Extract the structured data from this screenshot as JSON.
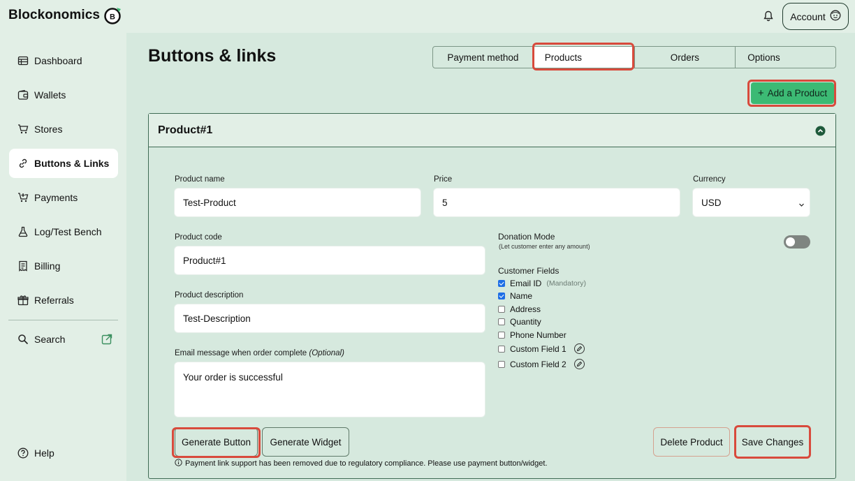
{
  "brand": {
    "name": "Blockonomics",
    "logo_letter": "B"
  },
  "header": {
    "account_label": "Account"
  },
  "sidebar": {
    "items": [
      {
        "label": "Dashboard",
        "icon": "table-icon"
      },
      {
        "label": "Wallets",
        "icon": "wallet-icon"
      },
      {
        "label": "Stores",
        "icon": "cart-icon"
      },
      {
        "label": "Buttons & Links",
        "icon": "link-icon",
        "active": true
      },
      {
        "label": "Payments",
        "icon": "cart-plus-icon"
      },
      {
        "label": "Log/Test Bench",
        "icon": "flask-icon"
      },
      {
        "label": "Billing",
        "icon": "receipt-icon"
      },
      {
        "label": "Referrals",
        "icon": "gift-icon"
      }
    ],
    "search_label": "Search",
    "help_label": "Help"
  },
  "page": {
    "title": "Buttons & links"
  },
  "tabs": [
    {
      "label": "Payment method"
    },
    {
      "label": "Products",
      "active": true
    },
    {
      "label": "Orders"
    },
    {
      "label": "Options"
    }
  ],
  "add_product_label": "Add a Product",
  "product": {
    "title": "Product#1",
    "name_label": "Product name",
    "name_value": "Test-Product",
    "price_label": "Price",
    "price_value": "5",
    "currency_label": "Currency",
    "currency_value": "USD",
    "code_label": "Product code",
    "code_value": "Product#1",
    "description_label": "Product description",
    "description_value": "Test-Description",
    "email_label": "Email message when order complete",
    "email_optional": "(Optional)",
    "email_value": "Your order is successful",
    "donation_label": "Donation Mode",
    "donation_hint": "(Let customer enter any amount)",
    "donation_enabled": false,
    "customer_fields_label": "Customer Fields",
    "customer_fields": [
      {
        "label": "Email ID",
        "checked": true,
        "note": "(Mandatory)"
      },
      {
        "label": "Name",
        "checked": true
      },
      {
        "label": "Address",
        "checked": false
      },
      {
        "label": "Quantity",
        "checked": false
      },
      {
        "label": "Phone Number",
        "checked": false
      },
      {
        "label": "Custom Field 1",
        "checked": false,
        "editable": true
      },
      {
        "label": "Custom Field 2",
        "checked": false,
        "editable": true
      }
    ]
  },
  "actions": {
    "generate_button": "Generate Button",
    "generate_widget": "Generate Widget",
    "delete_product": "Delete Product",
    "save_changes": "Save Changes"
  },
  "notice": "Payment link support has been removed due to regulatory compliance. Please use payment button/widget.",
  "colors": {
    "background": "#d6e9de",
    "panel": "#e2efe6",
    "accent": "#3cba74",
    "highlight": "#d84a3c",
    "text": "#111111"
  }
}
